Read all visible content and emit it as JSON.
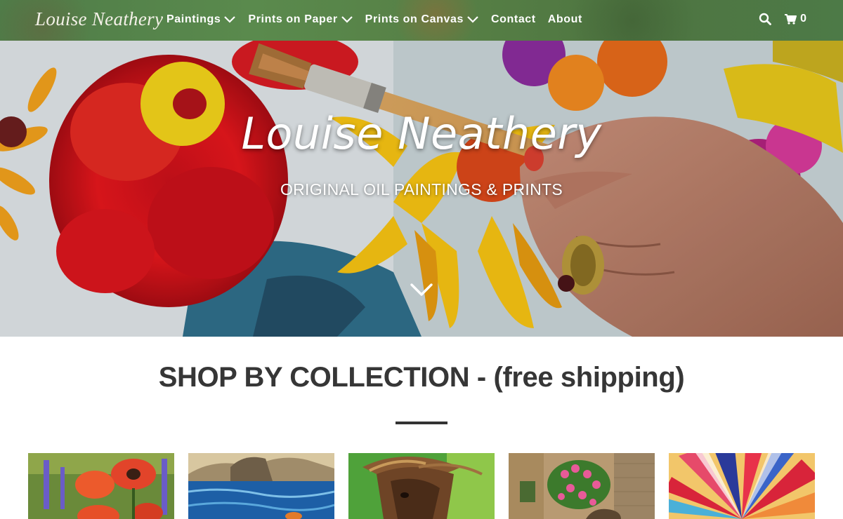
{
  "header": {
    "logo": "Louise Neathery",
    "nav": [
      {
        "label": "Paintings",
        "dropdown": true
      },
      {
        "label": "Prints on Paper",
        "dropdown": true
      },
      {
        "label": "Prints on Canvas",
        "dropdown": true
      },
      {
        "label": "Contact",
        "dropdown": false
      },
      {
        "label": "About",
        "dropdown": false
      }
    ],
    "search_icon": "search-icon",
    "cart_icon": "cart-icon",
    "cart_count": "0",
    "background_color": "#567f45"
  },
  "hero": {
    "title": "Louise Neathery",
    "subtitle": "ORIGINAL OIL PAINTINGS & PRINTS",
    "scroll_icon": "chevron-down-icon"
  },
  "collections_section": {
    "heading": "SHOP BY COLLECTION - (free shipping)",
    "tiles": [
      {
        "subject": "poppies"
      },
      {
        "subject": "coastal-water"
      },
      {
        "subject": "horse"
      },
      {
        "subject": "flower-doorway"
      },
      {
        "subject": "abstract-burst"
      }
    ]
  },
  "colors": {
    "heading_text": "#363636",
    "divider": "#333333",
    "nav_text": "#ffffff"
  }
}
